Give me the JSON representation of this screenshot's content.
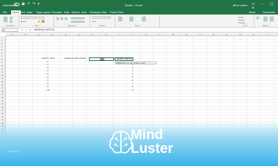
{
  "titlebar": {
    "autosave": "AutoSave",
    "doc_title": "Book1 - Excel",
    "user": "Mind Luster"
  },
  "tabs": [
    "File",
    "Home",
    "Insert",
    "Draw",
    "Page Layout",
    "Formulas",
    "Data",
    "Review",
    "View",
    "Developer",
    "Help",
    "Power Pivot"
  ],
  "share": "Share",
  "comments": "Comments",
  "ribbon": {
    "groups": [
      "Clipboard",
      "Font",
      "Alignment",
      "Number",
      "Styles",
      "Cells",
      "Editing"
    ],
    "insert": "Insert",
    "delete": "Delete",
    "format": "Format"
  },
  "formula_bar": {
    "name_box": "IF",
    "fx": "fx",
    "content": "=INDEX(I:I,MATCH("
  },
  "columns": [
    "A",
    "B",
    "C",
    "D",
    "E",
    "F",
    "G",
    "H",
    "I",
    "J",
    "K",
    "L",
    "M",
    "N",
    "O",
    "P",
    "Q",
    "R",
    "S",
    "T"
  ],
  "rows": [
    "1",
    "2",
    "3",
    "4",
    "5",
    "6",
    "7",
    "8",
    "9",
    "10",
    "11",
    "12",
    "13",
    "14",
    "15",
    "16",
    "17",
    "18",
    "19",
    "20",
    "21",
    "22",
    "23",
    "24",
    "25",
    "26",
    "27",
    "28",
    "29",
    "30",
    "31",
    "32",
    "33",
    "34",
    "35"
  ],
  "headers": {
    "order_id": "order ID",
    "name": "name",
    "lookup": "lookup the order number",
    "result": "used look down"
  },
  "order_ids": [
    "1",
    "2",
    "3",
    "4",
    "5",
    "6",
    "7",
    "8",
    "9",
    "10"
  ],
  "result_values": [
    "1",
    "2",
    "3",
    "4",
    "5",
    "6",
    "7",
    "8",
    "9"
  ],
  "edit_cell": "=INDEX(I:I,MATCH(",
  "tooltip": "INDEX(array, row_num, [column_num])",
  "watermark": {
    "line1": "Mind",
    "line2": "Luster"
  }
}
